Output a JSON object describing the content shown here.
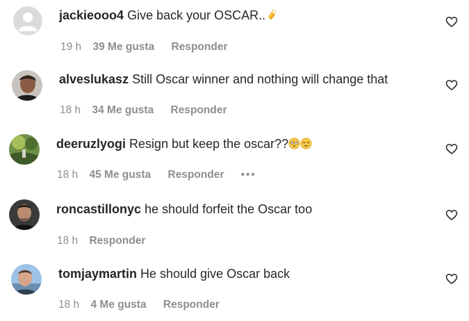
{
  "comments": [
    {
      "username": "jackieooo4",
      "text": "Give back your OSCAR..",
      "emoji": "clap-emoji",
      "time": "19 h",
      "likes": "39 Me gusta",
      "reply": "Responder",
      "avatar": "default-avatar"
    },
    {
      "username": "alveslukasz",
      "text": "Still Oscar winner and nothing will change that",
      "time": "18 h",
      "likes": "34 Me gusta",
      "reply": "Responder",
      "avatar": "photo-avatar"
    },
    {
      "username": "deeruzlyogi",
      "text": "Resign but keep the oscar??",
      "emoji": "flushed-face-emoji, expressionless-face-emoji",
      "time": "18 h",
      "likes": "45 Me gusta",
      "reply": "Responder",
      "more": "•••",
      "avatar": "photo-avatar"
    },
    {
      "username": "roncastillonyc",
      "text": "he should forfeit the Oscar too",
      "time": "18 h",
      "reply": "Responder",
      "avatar": "photo-avatar"
    },
    {
      "username": "tomjaymartin",
      "text": "He should give Oscar back",
      "time": "18 h",
      "likes": "4 Me gusta",
      "reply": "Responder",
      "avatar": "photo-avatar"
    }
  ],
  "icons": {
    "like": "heart-outline-icon"
  },
  "colors": {
    "text": "#262626",
    "meta": "#8e8e8e"
  }
}
